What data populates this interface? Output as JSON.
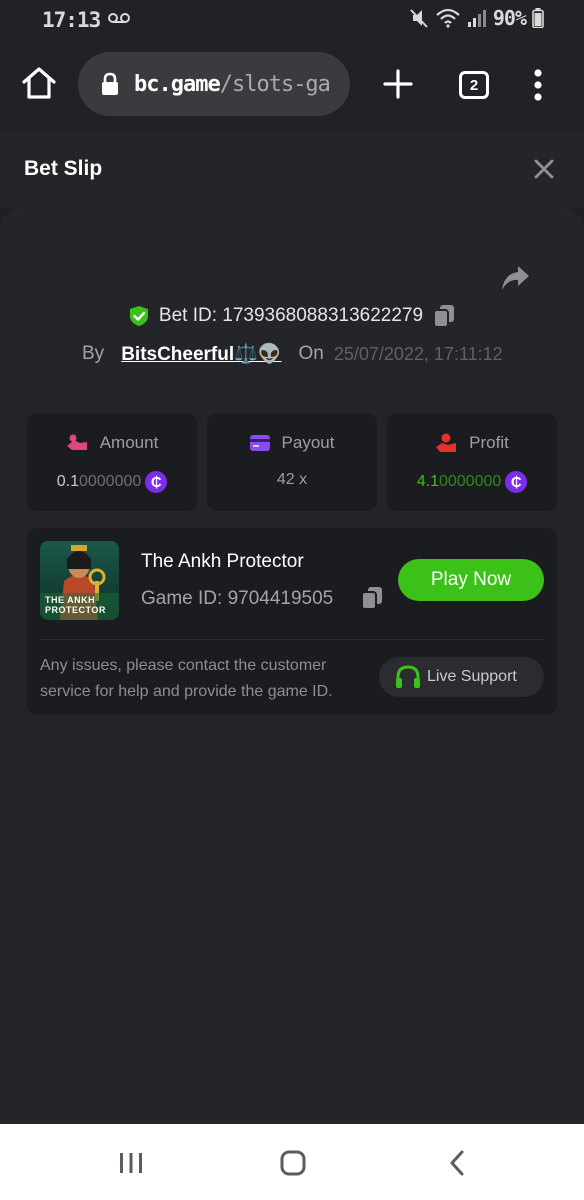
{
  "status_bar": {
    "time": "17:13",
    "battery": "90%"
  },
  "browser": {
    "url_domain": "bc.game",
    "url_path": "/slots-ga",
    "tab_count": "2"
  },
  "header": {
    "title": "Bet Slip"
  },
  "bet": {
    "bet_id_label": "Bet ID: 1739368088313622279",
    "by_label": "By",
    "user": "BitsCheerful⚖️👽",
    "on_label": "On",
    "date": "25/07/2022, 17:11:12"
  },
  "stats": {
    "amount": {
      "label": "Amount",
      "value_main": "0.1",
      "value_rest": "0000000"
    },
    "payout": {
      "label": "Payout",
      "value": "42 x"
    },
    "profit": {
      "label": "Profit",
      "value_main": "4.1",
      "value_rest": "0000000"
    },
    "coin_symbol": "₵"
  },
  "game": {
    "title": "The Ankh Protector",
    "game_id": "Game ID: 9704419505",
    "thumb_text_line1": "THE ANKH",
    "thumb_text_line2": "PROTECTOR",
    "play_label": "Play Now",
    "issue_text": "Any issues, please contact the customer service for help and provide the game ID.",
    "support_label": "Live Support"
  },
  "colors": {
    "accent_green": "#3bc117",
    "coin_purple": "#7e2bf0",
    "amount_icon": "#e2457b",
    "payout_icon": "#8a4cf0",
    "profit_icon": "#e5302f"
  },
  "icons": [
    "home-icon",
    "lock-icon",
    "plus-icon",
    "tabs-icon",
    "more-vert-icon",
    "close-icon",
    "share-icon",
    "shield-check-icon",
    "copy-icon",
    "hand-money-icon",
    "wallet-icon",
    "profit-hand-icon",
    "headset-icon",
    "recents-icon",
    "home-nav-icon",
    "back-icon"
  ]
}
